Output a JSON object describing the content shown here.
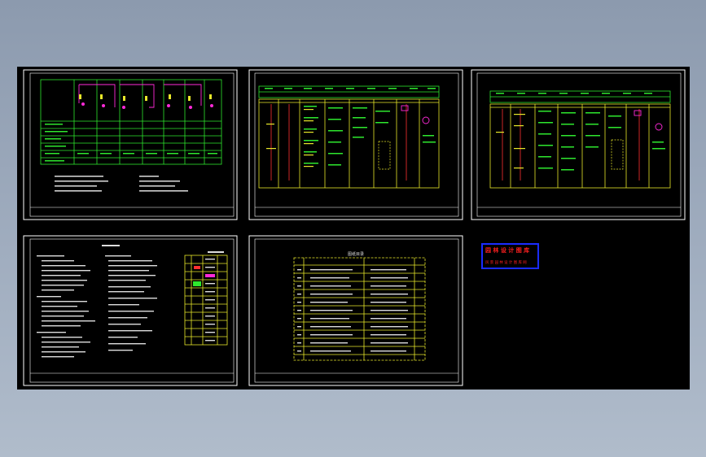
{
  "sheet2_title": "图纸目录",
  "stamp": {
    "line1": "园 林 设 计 图 库",
    "line2": "风 景 园 林 设 计 图 库 网"
  },
  "colors": {
    "background": "#000000",
    "border": "#ffffff",
    "yellow": "#e8e82a",
    "green": "#2ee82e",
    "magenta": "#ff2ad8",
    "red": "#ff3030",
    "stamp_blue": "#1a2cff",
    "stamp_red": "#ff2020"
  }
}
